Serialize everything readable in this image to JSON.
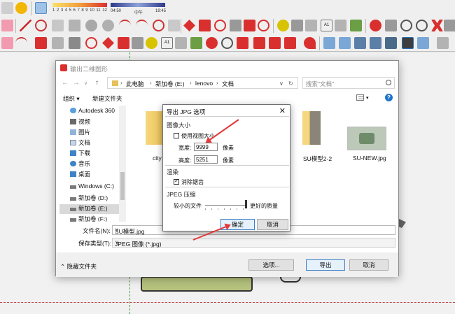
{
  "toolbar": {
    "color_scale_labels": [
      "1",
      "2",
      "3",
      "4",
      "5",
      "6",
      "7",
      "8",
      "9",
      "10",
      "11",
      "12"
    ],
    "time_start": "04:50",
    "time_mid": "中午",
    "time_end": "19:45"
  },
  "save_dialog": {
    "title": "输出二维图形",
    "breadcrumb": [
      "此电脑",
      "新加卷 (E:)",
      "lenovo",
      "文档"
    ],
    "search_placeholder": "搜索\"文档\"",
    "organize_label": "组织 ▾",
    "new_folder_label": "新建文件夹",
    "help_glyph": "?",
    "nav_items": [
      {
        "label": "Autodesk 360",
        "icon": "cloud-icon"
      },
      {
        "label": "视频",
        "icon": "video-icon"
      },
      {
        "label": "图片",
        "icon": "picture-icon"
      },
      {
        "label": "文档",
        "icon": "document-icon"
      },
      {
        "label": "下载",
        "icon": "download-icon"
      },
      {
        "label": "音乐",
        "icon": "music-icon"
      },
      {
        "label": "桌面",
        "icon": "desktop-icon"
      },
      {
        "label": "Windows (C:)",
        "icon": "drive-icon"
      },
      {
        "label": "新加卷 (D:)",
        "icon": "drive-icon"
      },
      {
        "label": "新加卷 (E:)",
        "icon": "drive-icon",
        "selected": true
      },
      {
        "label": "新加卷 (F:)",
        "icon": "drive-icon"
      }
    ],
    "files": [
      {
        "name": "city",
        "type": "folder"
      },
      {
        "name": "SU模型2-2",
        "type": "folder"
      },
      {
        "name": "SU-NEW.jpg",
        "type": "image"
      }
    ],
    "filename_label": "文件名(N):",
    "filename_value": "SU模型.jpg",
    "filetype_label": "保存类型(T):",
    "filetype_value": "JPEG 图像 (*.jpg)",
    "hide_folders_label": "隐藏文件夹",
    "options_button": "选项...",
    "export_button": "导出",
    "cancel_button": "取消"
  },
  "jpg_dialog": {
    "title": "导出 JPG 选项",
    "close_glyph": "✕",
    "image_size_group": "图像大小",
    "use_view_size_label": "使用视图大小",
    "use_view_size_checked": false,
    "width_label": "宽度:",
    "width_value": "9999",
    "height_label": "高度:",
    "height_value": "5251",
    "unit_label": "像素",
    "render_group": "渲染",
    "antialias_label": "消除锯齿",
    "antialias_checked": true,
    "jpeg_group": "JPEG 压缩",
    "smaller_file_label": "较小的文件",
    "better_quality_label": "更好的质量",
    "quality_fraction": 1.0,
    "ok_button": "确定",
    "cancel_button": "取消"
  },
  "colors": {
    "accent_red": "#e23a3a",
    "folder_yellow": "#e8c25a",
    "sketchup_red": "#d9302f"
  }
}
